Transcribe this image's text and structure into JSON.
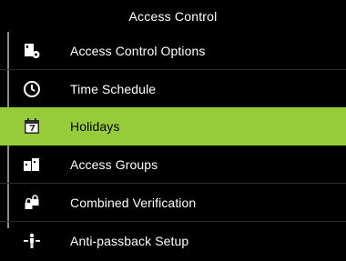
{
  "header": {
    "title": "Access Control"
  },
  "menu": {
    "items": [
      {
        "label": "Access Control Options",
        "icon": "access-control-options-icon"
      },
      {
        "label": "Time Schedule",
        "icon": "clock-icon"
      },
      {
        "label": "Holidays",
        "icon": "calendar-icon",
        "selected": true
      },
      {
        "label": "Access Groups",
        "icon": "access-groups-icon"
      },
      {
        "label": "Combined Verification",
        "icon": "locks-icon"
      },
      {
        "label": "Anti-passback Setup",
        "icon": "anti-passback-icon"
      }
    ]
  },
  "colors": {
    "background": "#000000",
    "selected_highlight": "#96cc3a",
    "text": "#ffffff",
    "selected_text": "#000000"
  }
}
